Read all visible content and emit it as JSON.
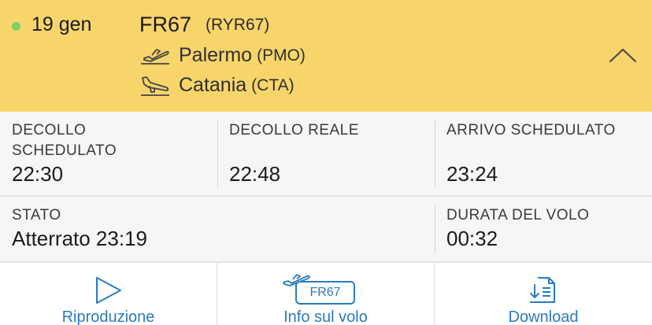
{
  "header": {
    "date": "19 gen",
    "flight_number": "FR67",
    "callsign": "(RYR67)",
    "departure": {
      "city": "Palermo",
      "code": "(PMO)"
    },
    "arrival": {
      "city": "Catania",
      "code": "(CTA)"
    },
    "status_dot_color": "#7fcf63",
    "accent_color": "#f8d56b"
  },
  "times": {
    "scheduled_departure": {
      "label_line1": "DECOLLO",
      "label_line2": "SCHEDULATO",
      "value": "22:30"
    },
    "actual_departure": {
      "label": "DECOLLO REALE",
      "value": "22:48"
    },
    "scheduled_arrival": {
      "label": "ARRIVO SCHEDULATO",
      "value": "23:24"
    }
  },
  "status": {
    "state": {
      "label": "STATO",
      "value": "Atterrato 23:19"
    },
    "duration": {
      "label": "DURATA DEL VOLO",
      "value": "00:32"
    }
  },
  "actions": {
    "playback": "Riproduzione",
    "flight_info": "Info sul volo",
    "flight_info_badge": "FR67",
    "download": "Download",
    "link_color": "#2a7bc0"
  }
}
